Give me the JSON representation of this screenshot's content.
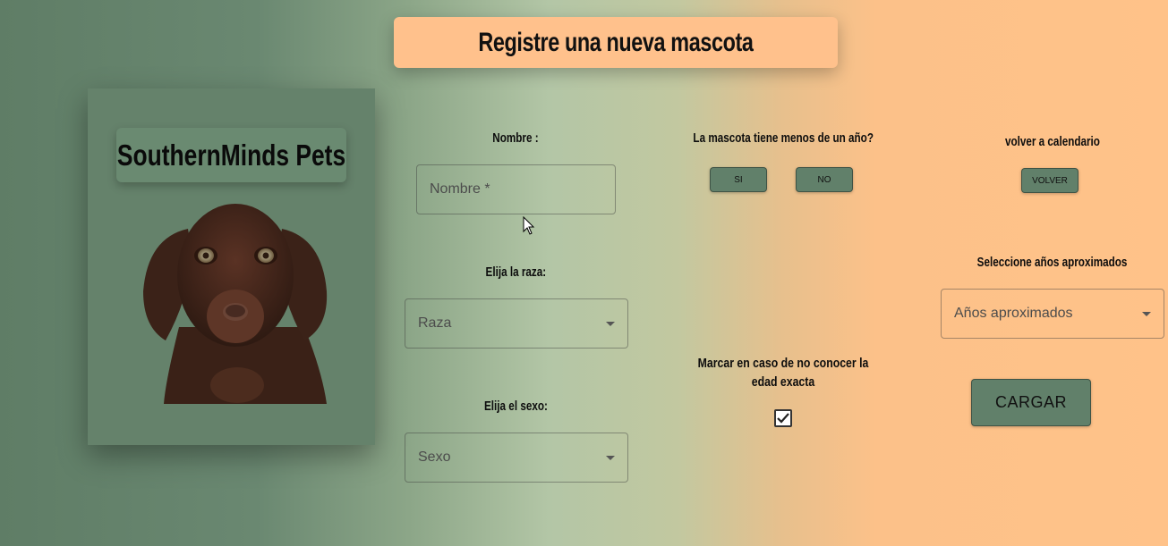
{
  "header": {
    "title": "Registre una nueva mascota"
  },
  "brand": {
    "name": "SouthernMinds Pets"
  },
  "form": {
    "name_label": "Nombre :",
    "name_placeholder": "Nombre *",
    "breed_label": "Elija la raza:",
    "breed_value": "Raza",
    "sex_label": "Elija el sexo:",
    "sex_value": "Sexo",
    "under_year_label": "La mascota tiene menos de un año?",
    "yes_label": "SI",
    "no_label": "NO",
    "unknown_age_label": "Marcar en caso de no conocer la edad exacta",
    "unknown_age_checked": true,
    "back_label": "volver a calendario",
    "back_button": "VOLVER",
    "years_label": "Seleccione años aproximados",
    "years_value": "Años aproximados",
    "submit_button": "CARGAR"
  },
  "colors": {
    "accent_peach": "#ffc18c",
    "accent_green": "#61806a"
  },
  "icons": [
    "dropdown-arrow-icon",
    "check-icon",
    "cursor-icon",
    "dog-photo"
  ]
}
